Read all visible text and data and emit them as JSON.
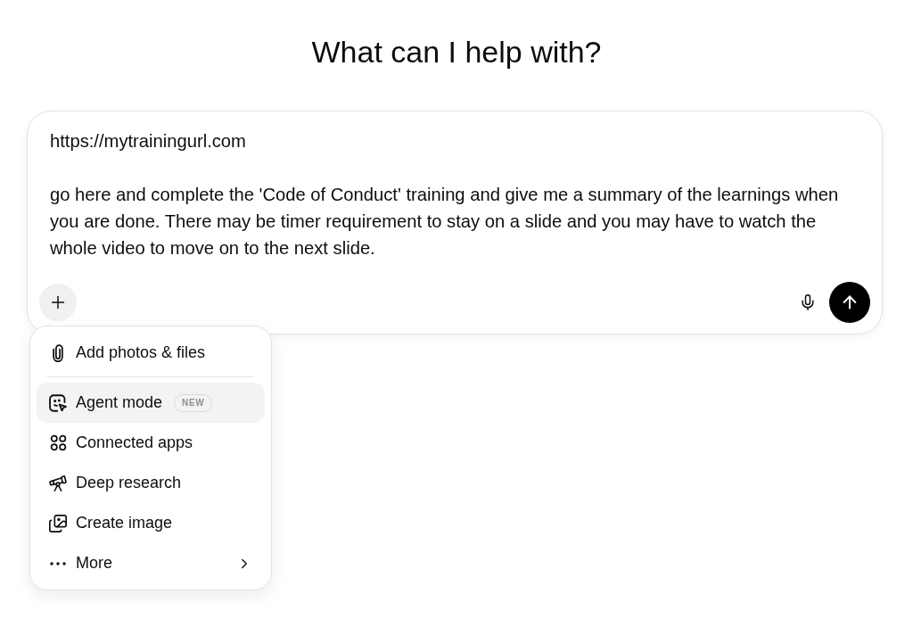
{
  "heading": "What can I help with?",
  "composer": {
    "value": "https://mytrainingurl.com\n\ngo here and complete the 'Code of Conduct' training and give me a summary of the learnings when you are done. There may be timer requirement to stay on a slide and you may have to watch the whole video to move on to the next slide."
  },
  "attach_menu": {
    "sections": [
      {
        "items": [
          {
            "label": "Add photos & files",
            "selected": false,
            "submenu": false
          }
        ]
      },
      {
        "items": [
          {
            "label": "Agent mode",
            "selected": true,
            "badge": "NEW",
            "submenu": false
          },
          {
            "label": "Connected apps",
            "selected": false,
            "submenu": false
          },
          {
            "label": "Deep research",
            "selected": false,
            "submenu": false
          },
          {
            "label": "Create image",
            "selected": false,
            "submenu": false
          },
          {
            "label": "More",
            "selected": false,
            "submenu": true
          }
        ]
      }
    ]
  }
}
